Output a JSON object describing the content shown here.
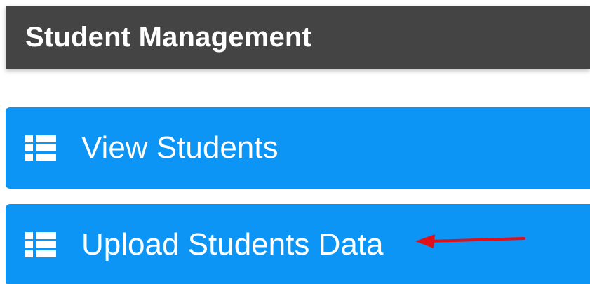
{
  "header": {
    "title": "Student Management"
  },
  "menu": {
    "items": [
      {
        "label": "View Students",
        "icon": "list-icon"
      },
      {
        "label": "Upload Students Data",
        "icon": "list-icon"
      }
    ]
  },
  "colors": {
    "header_bg": "#444444",
    "button_bg": "#0d95f5",
    "text": "#ffffff",
    "annotation_arrow": "#e0101a"
  }
}
